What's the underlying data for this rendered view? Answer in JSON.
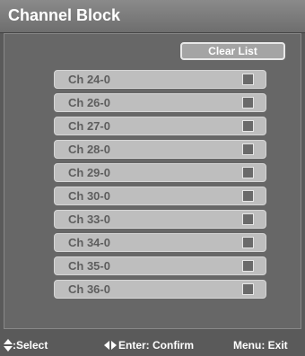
{
  "title": "Channel Block",
  "clear_button": "Clear List",
  "channels": [
    {
      "label": "Ch 24-0",
      "blocked": false
    },
    {
      "label": "Ch 26-0",
      "blocked": false
    },
    {
      "label": "Ch 27-0",
      "blocked": false
    },
    {
      "label": "Ch 28-0",
      "blocked": false
    },
    {
      "label": "Ch 29-0",
      "blocked": false
    },
    {
      "label": "Ch 30-0",
      "blocked": false
    },
    {
      "label": "Ch 33-0",
      "blocked": false
    },
    {
      "label": "Ch 34-0",
      "blocked": false
    },
    {
      "label": "Ch 35-0",
      "blocked": false
    },
    {
      "label": "Ch 36-0",
      "blocked": false
    }
  ],
  "footer": {
    "select": ":Select",
    "confirm": "Enter: Confirm",
    "exit": "Menu: Exit"
  },
  "icons": {
    "select": "up-down-arrows-icon",
    "confirm": "left-right-arrows-icon"
  }
}
